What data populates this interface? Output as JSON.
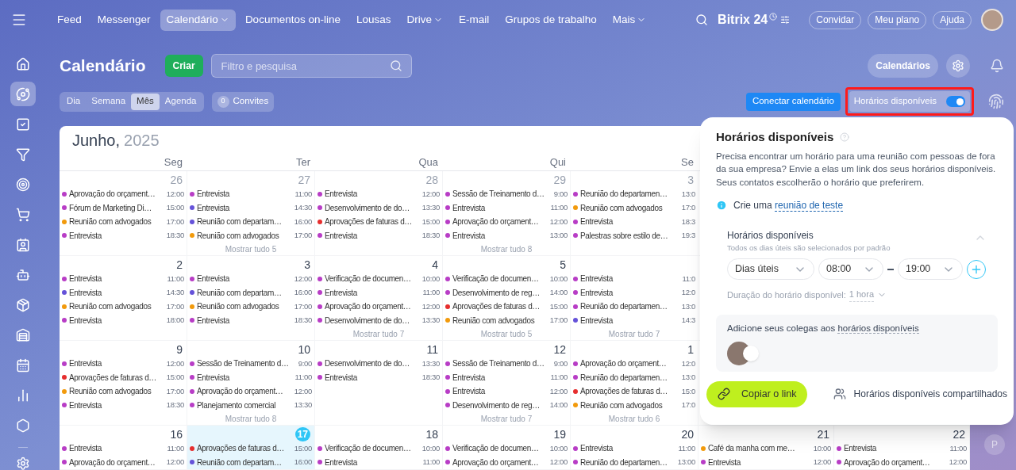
{
  "nav": {
    "items": [
      {
        "label": "Feed",
        "selected": false,
        "dropdown": false
      },
      {
        "label": "Messenger",
        "selected": false,
        "dropdown": false
      },
      {
        "label": "Calendário",
        "selected": true,
        "dropdown": true
      },
      {
        "label": "Documentos on-line",
        "selected": false,
        "dropdown": false
      },
      {
        "label": "Lousas",
        "selected": false,
        "dropdown": false
      },
      {
        "label": "Drive",
        "selected": false,
        "dropdown": true
      },
      {
        "label": "E-mail",
        "selected": false,
        "dropdown": false
      },
      {
        "label": "Grupos de trabalho",
        "selected": false,
        "dropdown": false
      },
      {
        "label": "Mais",
        "selected": false,
        "dropdown": true
      }
    ],
    "brand": "Bitrix 24",
    "buttons": [
      "Convidar",
      "Meu plano",
      "Ajuda"
    ]
  },
  "sidebar": {
    "items": [
      {
        "selected": false
      },
      {
        "selected": true
      },
      {
        "selected": false
      },
      {
        "selected": false
      },
      {
        "selected": false
      },
      {
        "selected": false
      },
      {
        "selected": false
      },
      {
        "selected": false
      },
      {
        "selected": false
      },
      {
        "selected": false
      },
      {
        "selected": false
      },
      {
        "selected": false
      },
      {
        "selected": false
      }
    ]
  },
  "toolbar": {
    "title": "Calendário",
    "create_button": "Criar",
    "search": {
      "placeholder": "Filtro e pesquisa"
    },
    "views": [
      {
        "label": "Dia",
        "selected": false
      },
      {
        "label": "Semana",
        "selected": false
      },
      {
        "label": "Mês",
        "selected": true
      },
      {
        "label": "Agenda",
        "selected": false
      }
    ],
    "invites": {
      "count": "0",
      "label": "Convites"
    },
    "calendars_button": "Calendários",
    "connect_button": "Conectar calendário",
    "availability_toggle": {
      "label": "Horários disponíveis",
      "on": true,
      "highlighted": true
    }
  },
  "calendar": {
    "month": "Junho,",
    "year": "2025",
    "weekdays": [
      "Seg",
      "Ter",
      "Qua",
      "Qui",
      "Se"
    ],
    "weeks": [
      {
        "days": [
          {
            "day": "26",
            "today": false,
            "events": [
              {
                "title": "Aprovação do orçament…",
                "time": "12:00",
                "color": "#b83dc6"
              },
              {
                "title": "Fórum de Marketing Di…",
                "time": "15:00",
                "color": "#b83dc6"
              },
              {
                "title": "Reunião com advogados",
                "time": "17:00",
                "color": "#f29a0c"
              },
              {
                "title": "Entrevista",
                "time": "18:30",
                "color": "#b83dc6"
              }
            ]
          },
          {
            "day": "27",
            "today": false,
            "events": [
              {
                "title": "Entrevista",
                "time": "11:00",
                "color": "#b83dc6"
              },
              {
                "title": "Entrevista",
                "time": "14:30",
                "color": "#6552d9"
              },
              {
                "title": "Reunião com departam…",
                "time": "16:00",
                "color": "#6552d9"
              },
              {
                "title": "Reunião com advogados",
                "time": "17:00",
                "color": "#f29a0c"
              }
            ],
            "more": "Mostrar tudo 5"
          },
          {
            "day": "28",
            "today": false,
            "events": [
              {
                "title": "Entrevista",
                "time": "12:00",
                "color": "#b83dc6"
              },
              {
                "title": "Desenvolvimento de do…",
                "time": "13:30",
                "color": "#b83dc6"
              },
              {
                "title": "Aprovações de faturas d…",
                "time": "15:00",
                "color": "#e62e2e"
              },
              {
                "title": "Entrevista",
                "time": "18:30",
                "color": "#b83dc6"
              }
            ]
          },
          {
            "day": "29",
            "today": false,
            "events": [
              {
                "title": "Sessão de Treinamento d…",
                "time": "9:00",
                "color": "#b83dc6"
              },
              {
                "title": "Entrevista",
                "time": "11:00",
                "color": "#b83dc6"
              },
              {
                "title": "Aprovação do orçament…",
                "time": "12:00",
                "color": "#b83dc6"
              },
              {
                "title": "Entrevista",
                "time": "13:00",
                "color": "#b83dc6"
              }
            ],
            "more": "Mostrar tudo 8"
          },
          {
            "day": "3",
            "today": false,
            "events": [
              {
                "title": "Reunião do departamen…",
                "time": "13:0",
                "color": "#b83dc6"
              },
              {
                "title": "Reunião com advogados",
                "time": "17:0",
                "color": "#f29a0c"
              },
              {
                "title": "Entrevista",
                "time": "18:3",
                "color": "#b83dc6"
              },
              {
                "title": "Palestras sobre estilo de…",
                "time": "19:3",
                "color": "#b83dc6"
              }
            ]
          }
        ]
      },
      {
        "days": [
          {
            "day": "2",
            "today": false,
            "events": [
              {
                "title": "Entrevista",
                "time": "11:00",
                "color": "#b83dc6"
              },
              {
                "title": "Entrevista",
                "time": "14:30",
                "color": "#6552d9"
              },
              {
                "title": "Reunião com advogados",
                "time": "17:00",
                "color": "#f29a0c"
              },
              {
                "title": "Entrevista",
                "time": "18:00",
                "color": "#b83dc6"
              }
            ]
          },
          {
            "day": "3",
            "today": false,
            "events": [
              {
                "title": "Entrevista",
                "time": "12:00",
                "color": "#b83dc6"
              },
              {
                "title": "Reunião com departam…",
                "time": "16:00",
                "color": "#6552d9"
              },
              {
                "title": "Reunião com advogados",
                "time": "17:00",
                "color": "#f29a0c"
              },
              {
                "title": "Entrevista",
                "time": "18:30",
                "color": "#b83dc6"
              }
            ]
          },
          {
            "day": "4",
            "today": false,
            "events": [
              {
                "title": "Verificação de documen…",
                "time": "10:00",
                "color": "#b83dc6"
              },
              {
                "title": "Entrevista",
                "time": "11:00",
                "color": "#b83dc6"
              },
              {
                "title": "Aprovação do orçament…",
                "time": "12:00",
                "color": "#b83dc6"
              },
              {
                "title": "Desenvolvimento de do…",
                "time": "13:30",
                "color": "#b83dc6"
              }
            ],
            "more": "Mostrar tudo 7"
          },
          {
            "day": "5",
            "today": false,
            "events": [
              {
                "title": "Verificação de documen…",
                "time": "10:00",
                "color": "#b83dc6"
              },
              {
                "title": "Desenvolvimento de reg…",
                "time": "14:00",
                "color": "#b83dc6"
              },
              {
                "title": "Aprovações de faturas d…",
                "time": "15:00",
                "color": "#e62e2e"
              },
              {
                "title": "Reunião com advogados",
                "time": "17:00",
                "color": "#f29a0c"
              }
            ],
            "more": "Mostrar tudo 5"
          },
          {
            "today": false,
            "events": [
              {
                "title": "Entrevista",
                "time": "11:0",
                "color": "#b83dc6"
              },
              {
                "title": "Entrevista",
                "time": "12:0",
                "color": "#b83dc6"
              },
              {
                "title": "Reunião do departamen…",
                "time": "13:0",
                "color": "#b83dc6"
              },
              {
                "title": "Entrevista",
                "time": "14:3",
                "color": "#6552d9"
              }
            ],
            "more": "Mostrar tudo 7"
          }
        ]
      },
      {
        "days": [
          {
            "day": "9",
            "today": false,
            "events": [
              {
                "title": "Entrevista",
                "time": "12:00",
                "color": "#b83dc6"
              },
              {
                "title": "Aprovações de faturas d…",
                "time": "15:00",
                "color": "#e62e2e"
              },
              {
                "title": "Reunião com advogados",
                "time": "17:00",
                "color": "#f29a0c"
              },
              {
                "title": "Entrevista",
                "time": "18:30",
                "color": "#b83dc6"
              }
            ]
          },
          {
            "day": "10",
            "today": false,
            "events": [
              {
                "title": "Sessão de Treinamento d…",
                "time": "9:00",
                "color": "#b83dc6"
              },
              {
                "title": "Entrevista",
                "time": "11:00",
                "color": "#b83dc6"
              },
              {
                "title": "Aprovação do orçament…",
                "time": "12:00",
                "color": "#b83dc6"
              },
              {
                "title": "Planejamento comercial",
                "time": "13:30",
                "color": "#b83dc6"
              }
            ],
            "more": "Mostrar tudo 8"
          },
          {
            "day": "11",
            "today": false,
            "events": [
              {
                "title": "Desenvolvimento de do…",
                "time": "13:30",
                "color": "#b83dc6"
              },
              {
                "title": "Entrevista",
                "time": "18:30",
                "color": "#b83dc6"
              }
            ]
          },
          {
            "day": "12",
            "today": false,
            "events": [
              {
                "title": "Sessão de Treinamento d…",
                "time": "9:00",
                "color": "#b83dc6"
              },
              {
                "title": "Entrevista",
                "time": "11:00",
                "color": "#b83dc6"
              },
              {
                "title": "Entrevista",
                "time": "12:00",
                "color": "#b83dc6"
              },
              {
                "title": "Desenvolvimento de reg…",
                "time": "14:00",
                "color": "#b83dc6"
              }
            ],
            "more": "Mostrar tudo 7"
          },
          {
            "day": "1",
            "today": false,
            "events": [
              {
                "title": "Aprovação do orçament…",
                "time": "12:0",
                "color": "#b83dc6"
              },
              {
                "title": "Reunião do departamen…",
                "time": "13:0",
                "color": "#b83dc6"
              },
              {
                "title": "Aprovações de faturas d…",
                "time": "15:0",
                "color": "#e62e2e"
              },
              {
                "title": "Reunião com advogados",
                "time": "17:0",
                "color": "#f29a0c"
              }
            ],
            "more": "Mostrar tudo 6"
          }
        ]
      },
      {
        "days": [
          {
            "day": "16",
            "today": false,
            "events": [
              {
                "title": "Entrevista",
                "time": "11:00",
                "color": "#b83dc6"
              },
              {
                "title": "Aprovação do orçament…",
                "time": "12:00",
                "color": "#b83dc6"
              }
            ]
          },
          {
            "day": "17",
            "today": true,
            "events": [
              {
                "title": "Aprovações de faturas d…",
                "time": "15:00",
                "color": "#e62e2e"
              },
              {
                "title": "Reunião com departam…",
                "time": "16:00",
                "color": "#6552d9"
              }
            ]
          },
          {
            "day": "18",
            "today": false,
            "events": [
              {
                "title": "Verificação de documen…",
                "time": "10:00",
                "color": "#b83dc6"
              },
              {
                "title": "Entrevista",
                "time": "11:00",
                "color": "#b83dc6"
              }
            ]
          },
          {
            "day": "19",
            "today": false,
            "events": [
              {
                "title": "Verificação de documen…",
                "time": "10:00",
                "color": "#b83dc6"
              },
              {
                "title": "Aprovação do orçament…",
                "time": "12:00",
                "color": "#b83dc6"
              }
            ]
          },
          {
            "day": "20",
            "today": false,
            "events": [
              {
                "title": "Entrevista",
                "time": "11:00",
                "color": "#b83dc6"
              },
              {
                "title": "Reunião do departamen…",
                "time": "13:00",
                "color": "#b83dc6"
              }
            ]
          },
          {
            "day": "21",
            "today": false,
            "events": [
              {
                "title": "Café da manha com me…",
                "time": "10:00",
                "color": "#f29a0c"
              },
              {
                "title": "Entrevista",
                "time": "12:00",
                "color": "#b83dc6"
              }
            ]
          },
          {
            "day": "22",
            "today": false,
            "events": [
              {
                "title": "Entrevista",
                "time": "11:00",
                "color": "#b83dc6"
              },
              {
                "title": "Aprovação do orçament…",
                "time": "12:00",
                "color": "#b83dc6"
              }
            ]
          }
        ]
      }
    ]
  },
  "popup": {
    "title": "Horários disponíveis",
    "description": "Precisa encontrar um horário para uma reunião com pessoas de fora da sua empresa? Envie a elas um link dos seus horários disponíveis. Seus contatos escolherão o horário que preferirem.",
    "info": {
      "text": "Crie uma",
      "link": "reunião de teste"
    },
    "schedule": {
      "title": "Horários disponíveis",
      "subtitle": "Todos os dias úteis são selecionados por padrão",
      "expanded": true,
      "days": "Dias úteis",
      "from": "08:00",
      "to": "19:00",
      "duration_label": "Duração do horário disponível:",
      "duration": "1 hora"
    },
    "colleagues": {
      "text": "Adicione seus colegas aos",
      "link": "horários disponíveis"
    },
    "copy_button": "Copiar o link",
    "shared_link": "Horários disponíveis compartilhados"
  },
  "corner_avatar": "P"
}
